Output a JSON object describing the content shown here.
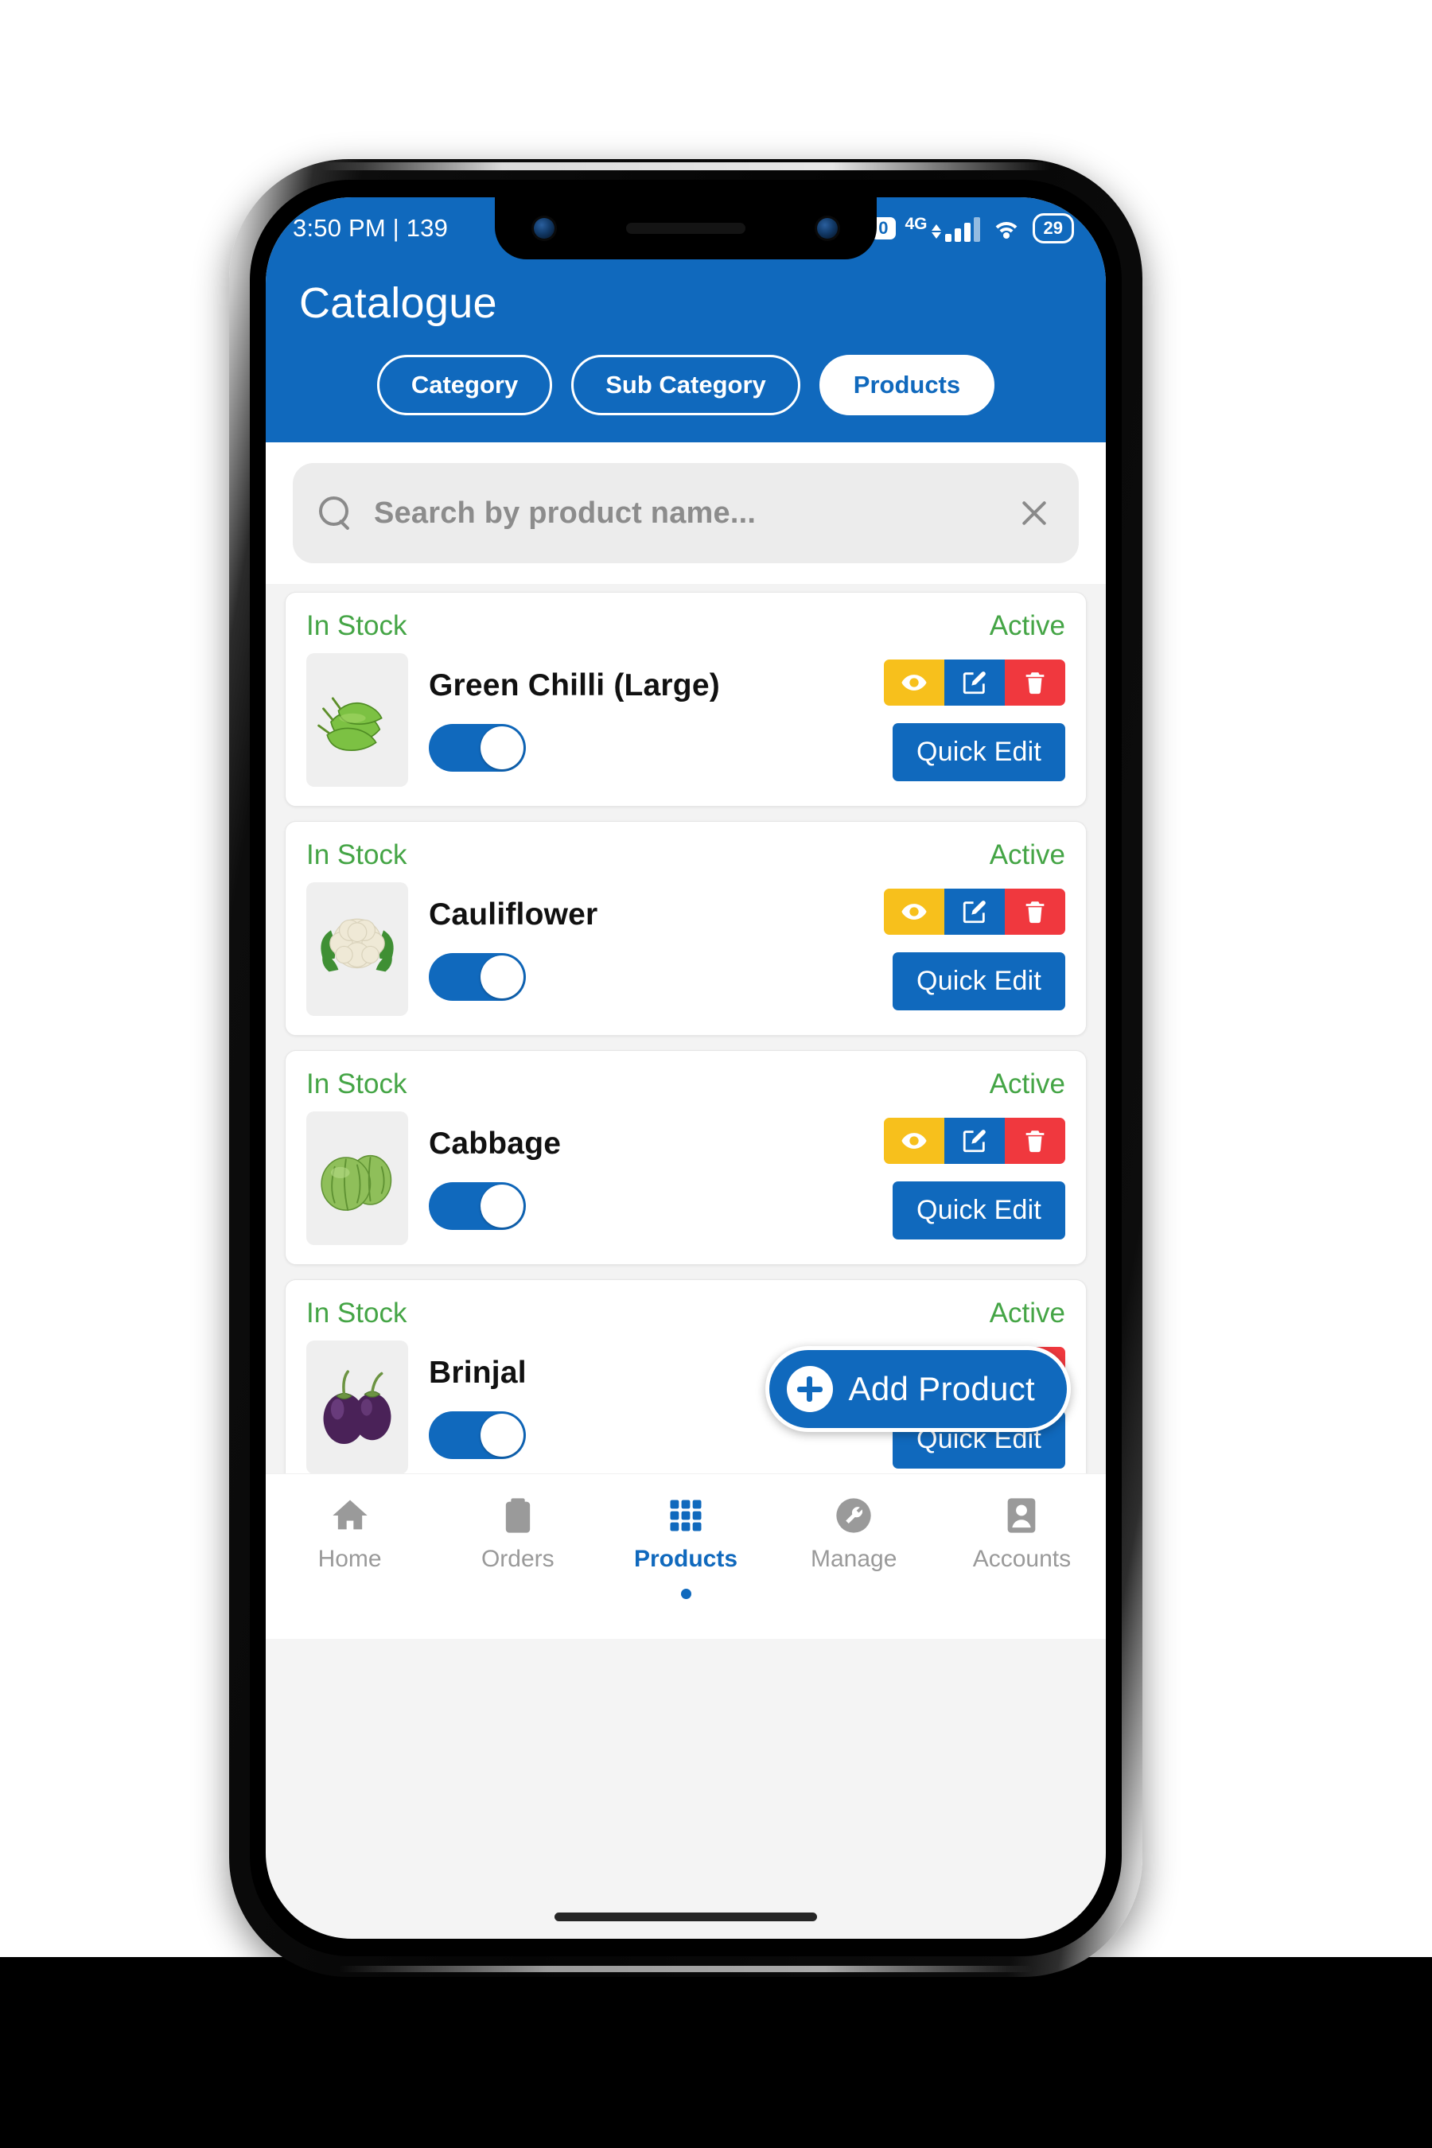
{
  "statusbar": {
    "left_text": "3:50 PM | 139",
    "notification_badge": "0",
    "network_type": "4G",
    "battery_level": "29",
    "icons": [
      "signal-icon",
      "wifi-icon",
      "battery-icon"
    ]
  },
  "header": {
    "title": "Catalogue",
    "tabs": [
      {
        "label": "Category",
        "active": false
      },
      {
        "label": "Sub Category",
        "active": false
      },
      {
        "label": "Products",
        "active": true
      }
    ]
  },
  "search": {
    "placeholder": "Search by product name...",
    "value": "",
    "search_icon": "search-icon",
    "clear_icon": "close-icon"
  },
  "products": [
    {
      "stock_label": "In Stock",
      "status_label": "Active",
      "name": "Green Chilli (Large)",
      "toggle_on": true,
      "quick_edit_label": "Quick Edit",
      "image": "green-chilli",
      "actions": [
        "eye-icon",
        "edit-icon",
        "trash-icon"
      ]
    },
    {
      "stock_label": "In Stock",
      "status_label": "Active",
      "name": "Cauliflower",
      "toggle_on": true,
      "quick_edit_label": "Quick Edit",
      "image": "cauliflower",
      "actions": [
        "eye-icon",
        "edit-icon",
        "trash-icon"
      ]
    },
    {
      "stock_label": "In Stock",
      "status_label": "Active",
      "name": "Cabbage",
      "toggle_on": true,
      "quick_edit_label": "Quick Edit",
      "image": "cabbage",
      "actions": [
        "eye-icon",
        "edit-icon",
        "trash-icon"
      ]
    },
    {
      "stock_label": "In Stock",
      "status_label": "Active",
      "name": "Brinjal",
      "toggle_on": true,
      "quick_edit_label": "Quick Edit",
      "image": "brinjal",
      "actions": [
        "eye-icon",
        "edit-icon",
        "trash-icon"
      ]
    }
  ],
  "fab": {
    "label": "Add Product",
    "icon": "plus-circle-icon"
  },
  "bottom_nav": [
    {
      "label": "Home",
      "icon": "home-icon",
      "active": false
    },
    {
      "label": "Orders",
      "icon": "clipboard-icon",
      "active": false
    },
    {
      "label": "Products",
      "icon": "grid-icon",
      "active": true
    },
    {
      "label": "Manage",
      "icon": "wrench-icon",
      "active": false
    },
    {
      "label": "Accounts",
      "icon": "person-icon",
      "active": false
    }
  ],
  "colors": {
    "brand_blue": "#1069bd",
    "status_green": "#45a546",
    "action_view": "#f7c01c",
    "action_edit": "#1069bd",
    "action_delete": "#f0383e",
    "search_bg": "#ececec",
    "list_bg": "#f3f3f3"
  }
}
